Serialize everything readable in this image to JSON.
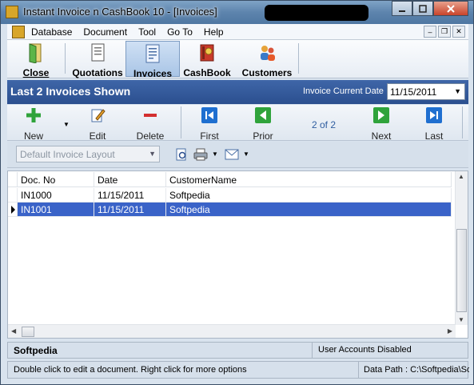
{
  "window": {
    "title": "Instant Invoice n CashBook 10 - [Invoices]",
    "controls": [
      "minimize",
      "maximize",
      "close"
    ]
  },
  "menu": {
    "items": [
      "Database",
      "Document",
      "Tool",
      "Go To",
      "Help"
    ]
  },
  "main_toolbar": {
    "buttons": [
      {
        "label": "Close",
        "icon": "close-door-icon"
      },
      {
        "label": "Quotations",
        "icon": "quotations-icon"
      },
      {
        "label": "Invoices",
        "icon": "invoices-icon",
        "active": true
      },
      {
        "label": "CashBook",
        "icon": "cashbook-icon"
      },
      {
        "label": "Customers",
        "icon": "customers-icon"
      }
    ]
  },
  "header": {
    "title": "Last 2 Invoices Shown",
    "date_label": "Invoice Current Date",
    "date_value": "11/15/2011"
  },
  "nav": {
    "new_label": "New",
    "edit_label": "Edit",
    "delete_label": "Delete",
    "first_label": "First",
    "prior_label": "Prior",
    "page_text": "2 of 2",
    "next_label": "Next",
    "last_label": "Last"
  },
  "layout_select": {
    "value": "Default Invoice Layout"
  },
  "grid": {
    "columns": [
      "Doc. No",
      "Date",
      "CustomerName"
    ],
    "rows": [
      {
        "doc_no": "IN1000",
        "date": "11/15/2011",
        "customer": "Softpedia",
        "selected": false
      },
      {
        "doc_no": "IN1001",
        "date": "11/15/2011",
        "customer": "Softpedia",
        "selected": true
      }
    ]
  },
  "status": {
    "company": "Softpedia",
    "accounts": "User Accounts Disabled",
    "hint": "Double click to edit a document. Right click for more options",
    "data_path": "Data Path : C:\\Softpedia\\So"
  },
  "colors": {
    "header_bg": "#2b4f8f",
    "selection": "#3a63c8",
    "panel": "#d6e0eb"
  }
}
